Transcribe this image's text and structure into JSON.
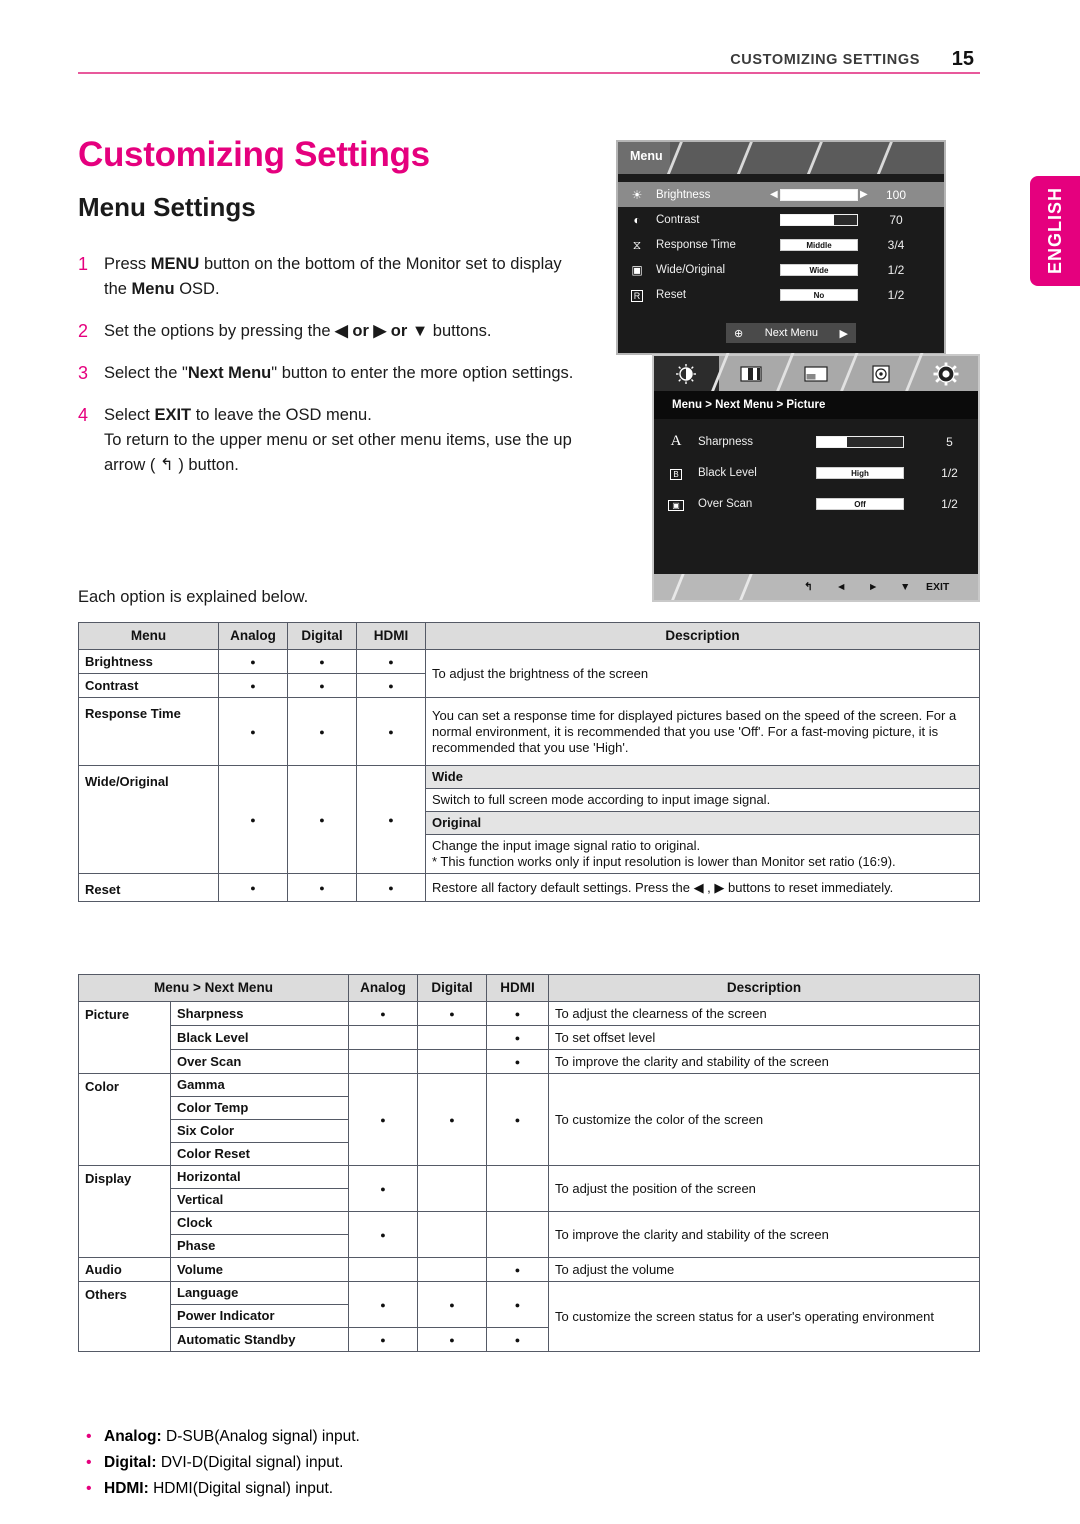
{
  "header": {
    "running_title": "CUSTOMIZING SETTINGS",
    "page_number": "15",
    "accent_color": "#e8599c"
  },
  "language_tab": {
    "label": "ENGLISH",
    "color": "#e5007e"
  },
  "headings": {
    "title": "Customizing Settings",
    "subtitle": "Menu Settings",
    "title_color": "#e5007e"
  },
  "steps": [
    {
      "num": "1",
      "text_a": "Press ",
      "bold_a": "MENU",
      "text_b": " button on the bottom of the Monitor set to display the ",
      "bold_b": "Menu",
      "text_c": " OSD."
    },
    {
      "num": "2",
      "text_a": "Set the options by pressing the ",
      "bold_a": "◀ or ▶ or ▼",
      "text_b": " buttons.",
      "bold_b": "",
      "text_c": ""
    },
    {
      "num": "3",
      "text_a": "Select the \"",
      "bold_a": "Next Menu",
      "text_b": "\" button to enter the more option settings.",
      "bold_b": "",
      "text_c": ""
    },
    {
      "num": "4",
      "text_a": "Select ",
      "bold_a": "EXIT",
      "text_b": " to leave the OSD menu.",
      "bold_b": "",
      "text_c": "",
      "extra": "To return to the upper menu or set other menu items, use the up arrow ( ↰ ) button."
    }
  ],
  "each_option_line": "Each option is explained below.",
  "osd_menu": {
    "tab_label": "Menu",
    "rows": [
      {
        "icon": "brightness-icon",
        "glyph": "☀",
        "name": "Brightness",
        "control": "slider",
        "fill": 100,
        "value": "100",
        "highlight": true,
        "arrows": true
      },
      {
        "icon": "contrast-icon",
        "glyph": "◐",
        "name": "Contrast",
        "control": "slider",
        "fill": 70,
        "value": "70",
        "highlight": false,
        "arrows": false
      },
      {
        "icon": "response-icon",
        "glyph": "⧖",
        "name": "Response Time",
        "control": "option",
        "option": "Middle",
        "value": "3/4",
        "highlight": false,
        "arrows": false
      },
      {
        "icon": "wide-icon",
        "glyph": "▣",
        "name": "Wide/Original",
        "control": "option",
        "option": "Wide",
        "value": "1/2",
        "highlight": false,
        "arrows": false
      },
      {
        "icon": "reset-icon",
        "glyph": "R",
        "name": "Reset",
        "control": "option",
        "option": "No",
        "value": "1/2",
        "highlight": false,
        "arrows": false
      }
    ],
    "next_menu_label": "Next Menu",
    "next_menu_plus": "⊕",
    "next_menu_arrow": "▶"
  },
  "osd_next_menu": {
    "tabs": [
      {
        "name": "tab-picture",
        "glyph": "☀",
        "active": true
      },
      {
        "name": "tab-color",
        "glyph": "▥",
        "active": false
      },
      {
        "name": "tab-display",
        "glyph": "▧",
        "active": false
      },
      {
        "name": "tab-audio",
        "glyph": "◉",
        "active": false
      },
      {
        "name": "tab-others",
        "glyph": "⚙",
        "active": false
      }
    ],
    "breadcrumb": "Menu  >  Next Menu  >  Picture",
    "rows": [
      {
        "icon": "sharpness-icon",
        "glyph": "A",
        "name": "Sharpness",
        "control": "slider",
        "fill": 35,
        "value": "5"
      },
      {
        "icon": "black-level-icon",
        "glyph": "⊞",
        "name": "Black Level",
        "control": "option",
        "option": "High",
        "value": "1/2"
      },
      {
        "icon": "over-scan-icon",
        "glyph": "❐",
        "name": "Over Scan",
        "control": "option",
        "option": "Off",
        "value": "1/2"
      }
    ],
    "nav": {
      "up": "↰",
      "left": "◄",
      "right": "►",
      "down": "▼",
      "exit": "EXIT"
    }
  },
  "table1": {
    "headers": [
      "Menu",
      "Analog",
      "Digital",
      "HDMI",
      "Description"
    ],
    "rows": [
      {
        "menu": "Brightness",
        "analog": true,
        "digital": true,
        "hdmi": true,
        "desc": "To adjust the brightness of the screen"
      },
      {
        "menu": "Contrast",
        "analog": true,
        "digital": true,
        "hdmi": true,
        "desc": ""
      },
      {
        "menu": "Response Time",
        "analog": true,
        "digital": true,
        "hdmi": true,
        "desc": "You can set a response time for displayed pictures based on the speed of the screen. For a normal environment, it is recommended that you use 'Off'. For a fast-moving picture, it is recommended that you use 'High'."
      },
      {
        "menu": "Wide/Original",
        "analog": true,
        "digital": true,
        "hdmi": true,
        "sub": [
          {
            "title": "Wide",
            "body": "Switch to full screen mode according to input image signal."
          },
          {
            "title": "Original",
            "body": "Change the input image signal ratio to original.\n* This function works only if input resolution is lower than Monitor set ratio (16:9)."
          }
        ]
      },
      {
        "menu": "Reset",
        "analog": true,
        "digital": true,
        "hdmi": true,
        "desc": "Restore all factory default settings. Press the ◀ , ▶ buttons to reset immediately."
      }
    ]
  },
  "table2": {
    "headers": [
      "Menu > Next Menu",
      "Analog",
      "Digital",
      "HDMI",
      "Description"
    ],
    "groups": [
      {
        "group": "Picture",
        "items": [
          {
            "name": "Sharpness",
            "analog": true,
            "digital": true,
            "hdmi": true,
            "desc": "To adjust the clearness of the screen"
          },
          {
            "name": "Black Level",
            "analog": false,
            "digital": false,
            "hdmi": true,
            "desc": "To set offset level"
          },
          {
            "name": "Over Scan",
            "analog": false,
            "digital": false,
            "hdmi": true,
            "desc": "To improve the clarity and stability of the screen"
          }
        ]
      },
      {
        "group": "Color",
        "desc": "To customize the color of the screen",
        "analog": true,
        "digital": true,
        "hdmi": true,
        "items": [
          {
            "name": "Gamma"
          },
          {
            "name": "Color Temp"
          },
          {
            "name": "Six Color"
          },
          {
            "name": "Color Reset"
          }
        ]
      },
      {
        "group": "Display",
        "blocks": [
          {
            "desc": "To adjust the position of the screen",
            "analog": true,
            "digital": false,
            "hdmi": false,
            "items": [
              {
                "name": "Horizontal"
              },
              {
                "name": "Vertical"
              }
            ]
          },
          {
            "desc": "To improve the clarity and stability of the screen",
            "analog": true,
            "digital": false,
            "hdmi": false,
            "items": [
              {
                "name": "Clock"
              },
              {
                "name": "Phase"
              }
            ]
          }
        ]
      },
      {
        "group": "Audio",
        "items": [
          {
            "name": "Volume",
            "analog": false,
            "digital": false,
            "hdmi": true,
            "desc": "To adjust the volume"
          }
        ]
      },
      {
        "group": "Others",
        "desc": "To customize the screen status for a user's operating environment",
        "items": [
          {
            "name": "Language",
            "analog": true,
            "digital": true,
            "hdmi": true
          },
          {
            "name": "Power Indicator",
            "analog": true,
            "digital": true,
            "hdmi": true
          },
          {
            "name": "Automatic Standby",
            "analog": true,
            "digital": true,
            "hdmi": true
          }
        ]
      }
    ]
  },
  "footnotes": [
    {
      "term": "Analog:",
      "rest": " D-SUB(Analog signal) input."
    },
    {
      "term": "Digital:",
      "rest": " DVI-D(Digital signal) input."
    },
    {
      "term": "HDMI:",
      "rest": " HDMI(Digital signal) input."
    }
  ]
}
